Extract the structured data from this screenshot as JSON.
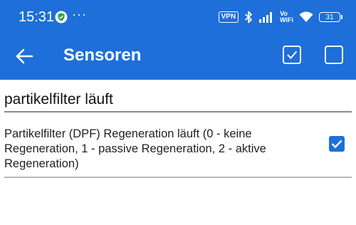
{
  "status_bar": {
    "time": "15:31",
    "more_dots": "···",
    "vpn_label": "VPN",
    "vowifi_top": "Vo",
    "vowifi_bottom": "WiFi",
    "battery_level": "31"
  },
  "app_bar": {
    "title": "Sensoren",
    "back_icon": "arrow-back-icon",
    "select_all_icon": "checked-square-icon",
    "select_none_icon": "empty-square-icon"
  },
  "search": {
    "value": "partikelfilter läuft"
  },
  "sensors": [
    {
      "label": "Partikelfilter (DPF) Regeneration läuft (0 - keine Regeneration, 1 - passive Regeneration, 2 - aktive Regeneration)",
      "checked": true
    }
  ],
  "colors": {
    "primary": "#1e6fd9",
    "divider": "#b5b5b5",
    "text": "#222222"
  }
}
